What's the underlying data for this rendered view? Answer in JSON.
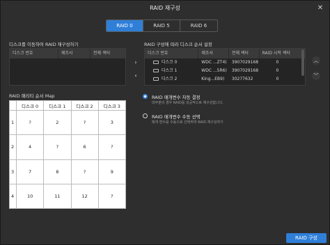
{
  "window": {
    "title": "RAID 재구성",
    "close": "✕"
  },
  "tabs": [
    "RAID 0",
    "RAID 5",
    "RAID 6"
  ],
  "left": {
    "heading": "디스크를 이동하여 RAID 재구성하기",
    "columns": [
      "디스크 번호",
      "제조사",
      "전체 섹터"
    ],
    "rows": []
  },
  "right": {
    "heading": "RAID 구성에 따라 디스크 순서 설정",
    "columns": [
      "디스크 번호",
      "제조사",
      "전체 섹터",
      "RAID 시작 섹터"
    ],
    "rows": [
      {
        "disk": "디스크 0",
        "maker": "WDC ...ZT4)",
        "sectors": "3907029168",
        "start": "0"
      },
      {
        "disk": "디스크 1",
        "maker": "WDC ...5R6)",
        "sectors": "3907029168",
        "start": "0"
      },
      {
        "disk": "디스크 2",
        "maker": "King...EB9)",
        "sectors": "30277632",
        "start": "0"
      }
    ]
  },
  "map": {
    "heading": "RAID 패리티 순서 Map",
    "columns": [
      "디스크 0",
      "디스크 1",
      "디스크 2",
      "디스크 3"
    ],
    "rows": [
      {
        "label": "1",
        "cells": [
          "?",
          "2",
          "?",
          "3"
        ]
      },
      {
        "label": "2",
        "cells": [
          "4",
          "?",
          "6",
          "?"
        ]
      },
      {
        "label": "3",
        "cells": [
          "7",
          "8",
          "?",
          "9"
        ]
      },
      {
        "label": "4",
        "cells": [
          "10",
          "11",
          "12",
          "?"
        ]
      }
    ]
  },
  "options": {
    "auto_title": "RAID 매개변수 자동 결정",
    "auto_desc": "대부분의 경우 RAID를 성공적으로 재구성합니다.",
    "manual_title": "RAID 매개변수 수동 선택",
    "manual_desc": "매개 변수를 수동으로 선택하여 RAID 재구성하기"
  },
  "icons": {
    "right": "›",
    "left": "‹",
    "up": "︿",
    "down": "﹀"
  },
  "action": "RAID 구성",
  "colors": {
    "accent": "#2f7fd8"
  }
}
